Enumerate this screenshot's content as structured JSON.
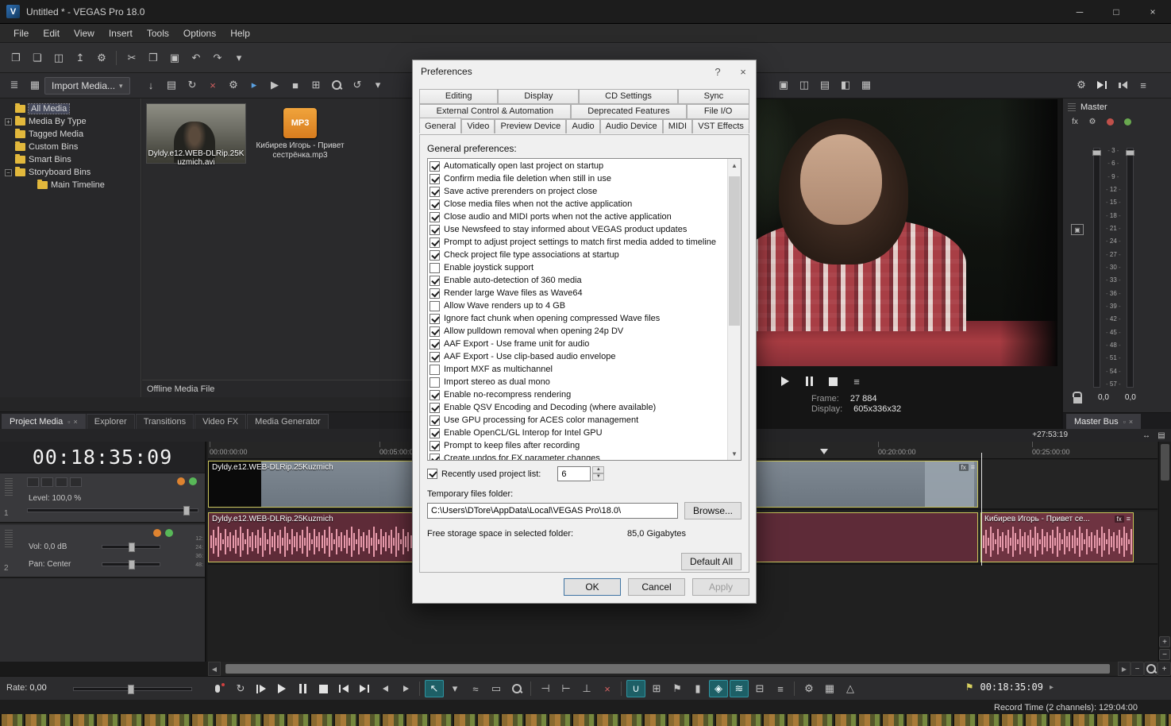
{
  "titlebar": {
    "title": "Untitled * - VEGAS Pro 18.0",
    "logo": "V",
    "buttons": [
      {
        "name": "minimize-button",
        "glyph": "─"
      },
      {
        "name": "maximize-button",
        "glyph": "□"
      },
      {
        "name": "close-button",
        "glyph": "×"
      }
    ]
  },
  "menu": [
    "File",
    "Edit",
    "View",
    "Insert",
    "Tools",
    "Options",
    "Help"
  ],
  "main_toolbar": [
    {
      "name": "new-project-button",
      "glyph": "❐"
    },
    {
      "name": "open-project-button",
      "glyph": "❏"
    },
    {
      "name": "save-project-button",
      "glyph": "◫"
    },
    {
      "name": "publish-project-button",
      "glyph": "↥"
    },
    {
      "name": "project-properties-button",
      "glyph": "⚙"
    },
    {
      "name": "separator",
      "kind": "sep"
    },
    {
      "name": "cut-button",
      "glyph": "✂"
    },
    {
      "name": "copy-button",
      "glyph": "❒"
    },
    {
      "name": "paste-button",
      "glyph": "▣"
    },
    {
      "name": "undo-button",
      "glyph": "↶"
    },
    {
      "name": "redo-button",
      "glyph": "↷"
    },
    {
      "name": "redo-dropdown",
      "glyph": "▾"
    }
  ],
  "media_toolbar": {
    "left_icons": [
      {
        "name": "docking-menu-button",
        "glyph": "≣"
      },
      {
        "name": "thumbnail-view-button",
        "glyph": "▦"
      }
    ],
    "import_label": "Import Media...",
    "import_caret": "▾",
    "right_icons": [
      {
        "name": "import-from-device-button",
        "glyph": "↓"
      },
      {
        "name": "capture-video-button",
        "glyph": "▤"
      },
      {
        "name": "refresh-button",
        "glyph": "↻"
      },
      {
        "name": "remove-media-button",
        "glyph": "×",
        "kind": "red"
      },
      {
        "name": "media-properties-button",
        "glyph": "⚙"
      },
      {
        "name": "preview-autoplay-button",
        "glyph": "▸",
        "kind": "blue"
      },
      {
        "name": "preview-start-button",
        "glyph": "▶"
      },
      {
        "name": "preview-stop-button",
        "glyph": "■"
      },
      {
        "name": "media-views-button",
        "glyph": "⊞"
      },
      {
        "name": "search-media-button",
        "kind": "zoomg"
      },
      {
        "name": "history-back-button",
        "glyph": "↺"
      },
      {
        "name": "views-dropdown",
        "glyph": "▾"
      }
    ]
  },
  "preview_toolbar": [
    {
      "name": "copy-snapshot-button",
      "glyph": "▣"
    },
    {
      "name": "save-snapshot-button",
      "glyph": "◫"
    },
    {
      "name": "video-output-settings-button",
      "glyph": "▤"
    },
    {
      "name": "split-screen-view-button",
      "glyph": "◧"
    },
    {
      "name": "grid-overlay-button",
      "glyph": "▦"
    }
  ],
  "master_toolbar": [
    {
      "name": "mixer-properties-button",
      "glyph": "⚙"
    },
    {
      "name": "goto-end-button",
      "kind": "goend"
    },
    {
      "name": "dim-output-button",
      "kind": "spk"
    },
    {
      "name": "mixer-layout-button",
      "glyph": "≡"
    }
  ],
  "media_panel": {
    "tree": [
      {
        "label": "All Media",
        "selected": true,
        "expander": ""
      },
      {
        "label": "Media By Type",
        "expander": "+"
      },
      {
        "label": "Tagged Media",
        "expander": ""
      },
      {
        "label": "Custom Bins",
        "expander": ""
      },
      {
        "label": "Smart Bins",
        "expander": ""
      },
      {
        "label": "Storyboard Bins",
        "expander": "−"
      },
      {
        "label": "Main Timeline",
        "expander": "",
        "kind": "lvl2"
      }
    ],
    "items": [
      {
        "caption": "Dyldy.e12.WEB-DLRip.25Kuzmich.avi",
        "kind": "video"
      },
      {
        "caption": "Кибирев Игорь - Привет сестрёнка.mp3",
        "kind": "audio",
        "badge": "MP3"
      }
    ],
    "status_text": "Offline Media File",
    "tabs": [
      {
        "label": "Project Media",
        "active": true
      },
      {
        "label": "Explorer"
      },
      {
        "label": "Transitions"
      },
      {
        "label": "Video FX"
      },
      {
        "label": "Media Generator"
      }
    ]
  },
  "preferences": {
    "title": "Preferences",
    "help_button": "?",
    "close_button": "×",
    "tabs_row1": [
      {
        "label": "Editing"
      },
      {
        "label": "Display"
      },
      {
        "label": "CD Settings"
      },
      {
        "label": "Sync"
      }
    ],
    "tabs_row2": [
      {
        "label": "External Control & Automation"
      },
      {
        "label": "Deprecated Features"
      },
      {
        "label": "File I/O"
      }
    ],
    "tabs_row3": [
      {
        "label": "General",
        "active": true
      },
      {
        "label": "Video"
      },
      {
        "label": "Preview Device"
      },
      {
        "label": "Audio"
      },
      {
        "label": "Audio Device"
      },
      {
        "label": "MIDI"
      },
      {
        "label": "VST Effects"
      }
    ],
    "section_label": "General preferences:",
    "options": [
      {
        "label": "Automatically open last project on startup",
        "checked": true
      },
      {
        "label": "Confirm media file deletion when still in use",
        "checked": true
      },
      {
        "label": "Save active prerenders on project close",
        "checked": true
      },
      {
        "label": "Close media files when not the active application",
        "checked": true
      },
      {
        "label": "Close audio and MIDI ports when not the active application",
        "checked": true
      },
      {
        "label": "Use Newsfeed to stay informed about VEGAS product updates",
        "checked": true
      },
      {
        "label": "Prompt to adjust project settings to match first media added to timeline",
        "checked": true
      },
      {
        "label": "Check project file type associations at startup",
        "checked": true
      },
      {
        "label": "Enable joystick support",
        "checked": false
      },
      {
        "label": "Enable auto-detection of 360 media",
        "checked": true
      },
      {
        "label": "Render large Wave files as Wave64",
        "checked": true
      },
      {
        "label": "Allow Wave renders up to 4 GB",
        "checked": false
      },
      {
        "label": "Ignore fact chunk when opening compressed Wave files",
        "checked": true
      },
      {
        "label": "Allow pulldown removal when opening 24p DV",
        "checked": true
      },
      {
        "label": "AAF Export - Use frame unit for audio",
        "checked": true
      },
      {
        "label": "AAF Export - Use clip-based audio envelope",
        "checked": true
      },
      {
        "label": "Import MXF as multichannel",
        "checked": false
      },
      {
        "label": "Import stereo as dual mono",
        "checked": false
      },
      {
        "label": "Enable no-recompress rendering",
        "checked": true
      },
      {
        "label": "Enable QSV Encoding and Decoding (where available)",
        "checked": true
      },
      {
        "label": "Use GPU processing for ACES color management",
        "checked": true
      },
      {
        "label": "Enable OpenCL/GL Interop for Intel GPU",
        "checked": true
      },
      {
        "label": "Prompt to keep files after recording",
        "checked": true
      },
      {
        "label": "Create undos for FX parameter changes",
        "checked": true
      }
    ],
    "recent_label": "Recently used project list:",
    "recent_value": "6",
    "temp_label": "Temporary files folder:",
    "temp_path": "C:\\Users\\DTore\\AppData\\Local\\VEGAS Pro\\18.0\\",
    "browse_button": "Browse...",
    "free_label": "Free storage space in selected folder:",
    "free_value": "85,0 Gigabytes",
    "default_all_button": "Default All",
    "ok_button": "OK",
    "cancel_button": "Cancel",
    "apply_button": "Apply"
  },
  "preview": {
    "transport": [
      {
        "name": "preview-play-button",
        "kind": "play"
      },
      {
        "name": "preview-pause-button",
        "kind": "pause"
      },
      {
        "name": "preview-stop-button",
        "kind": "stop"
      },
      {
        "name": "preview-menu-button",
        "glyph": "≡"
      }
    ],
    "frame_label": "Frame:",
    "frame_value": "27 884",
    "display_label": "Display:",
    "display_value": "605x336x32"
  },
  "master": {
    "label": "Master",
    "fx_icons": [
      {
        "name": "master-fx-button",
        "glyph": "fx"
      },
      {
        "name": "master-properties-button",
        "glyph": "⚙"
      },
      {
        "name": "master-mute-button",
        "kind": "dot-red"
      },
      {
        "name": "master-solo-button",
        "kind": "dot-green"
      }
    ],
    "scale": [
      "3",
      "6",
      "9",
      "12",
      "15",
      "18",
      "21",
      "24",
      "27",
      "30",
      "33",
      "36",
      "39",
      "42",
      "45",
      "48",
      "51",
      "54",
      "57"
    ],
    "left_value": "0,0",
    "right_value": "0,0",
    "tab_label": "Master Bus"
  },
  "timeline": {
    "time_display": "00:18:35:09",
    "offset_label": "+27:53:19",
    "ruler_marks": [
      "00:00:00:00",
      "00:05:00:00",
      "00:20:00:00",
      "00:25:00:00"
    ],
    "fx_badge": "fx",
    "track1": {
      "number": "1",
      "level_label": "Level:",
      "level_value": "100,0 %",
      "clip_name": "Dyldy.e12.WEB-DLRip.25Kuzmich"
    },
    "track2": {
      "number": "2",
      "vol_label": "Vol:",
      "vol_value": "0,0 dB",
      "pan_label": "Pan:",
      "pan_value": "Center",
      "clip_name": "Dyldy.e12.WEB-DLRip.25Kuzmich",
      "clip2_name": "Кибирев Игорь - Привет се...",
      "meter_scale": [
        "12:",
        "24:",
        "36:",
        "48:"
      ]
    }
  },
  "transport": {
    "rate_label": "Rate:",
    "rate_value": "0,00",
    "time": "00:18:35:09",
    "icons": [
      {
        "name": "record-button",
        "kind": "mic"
      },
      {
        "name": "loop-playback-button",
        "glyph": "↻"
      },
      {
        "name": "play-from-start-button",
        "kind": "playstart"
      },
      {
        "name": "play-button",
        "kind": "play"
      },
      {
        "name": "pause-button",
        "kind": "pause"
      },
      {
        "name": "stop-button",
        "kind": "stop"
      },
      {
        "name": "go-to-start-button",
        "kind": "gostart"
      },
      {
        "name": "go-to-end-button",
        "kind": "goend"
      },
      {
        "name": "previous-frame-button",
        "kind": "prevf"
      },
      {
        "name": "next-frame-button",
        "kind": "nextf"
      },
      {
        "name": "separator",
        "kind": "sep"
      },
      {
        "name": "normal-edit-tool-button",
        "glyph": "↖",
        "active": true
      },
      {
        "name": "edit-tool-dropdown",
        "glyph": "▾"
      },
      {
        "name": "envelope-edit-tool-button",
        "glyph": "≈"
      },
      {
        "name": "selection-edit-tool-button",
        "glyph": "▭"
      },
      {
        "name": "zoom-edit-tool-button",
        "kind": "zoomg"
      },
      {
        "name": "separator",
        "kind": "sep"
      },
      {
        "name": "trim-start-button",
        "glyph": "⊣"
      },
      {
        "name": "trim-end-button",
        "glyph": "⊢"
      },
      {
        "name": "split-button",
        "glyph": "⊥"
      },
      {
        "name": "delete-button",
        "glyph": "×",
        "kind": "red"
      },
      {
        "name": "separator",
        "kind": "sep"
      },
      {
        "name": "snapping-button",
        "glyph": "∪",
        "active": true
      },
      {
        "name": "quantize-to-frames-button",
        "glyph": "⊞"
      },
      {
        "name": "insert-marker-button",
        "glyph": "⚑"
      },
      {
        "name": "insert-region-button",
        "glyph": "▮"
      },
      {
        "name": "auto-crossfades-button",
        "glyph": "◈",
        "active": true
      },
      {
        "name": "auto-ripple-button",
        "glyph": "≋",
        "active": true
      },
      {
        "name": "lock-envelopes-button",
        "glyph": "⊟"
      },
      {
        "name": "ignore-grouping-button",
        "glyph": "≡"
      },
      {
        "name": "separator",
        "kind": "sep"
      },
      {
        "name": "mixer-button",
        "glyph": "⚙"
      },
      {
        "name": "external-control-button",
        "glyph": "▦"
      },
      {
        "name": "metronome-button",
        "glyph": "△"
      }
    ]
  },
  "status": {
    "record_time": "Record Time (2 channels): 129:04:00"
  }
}
